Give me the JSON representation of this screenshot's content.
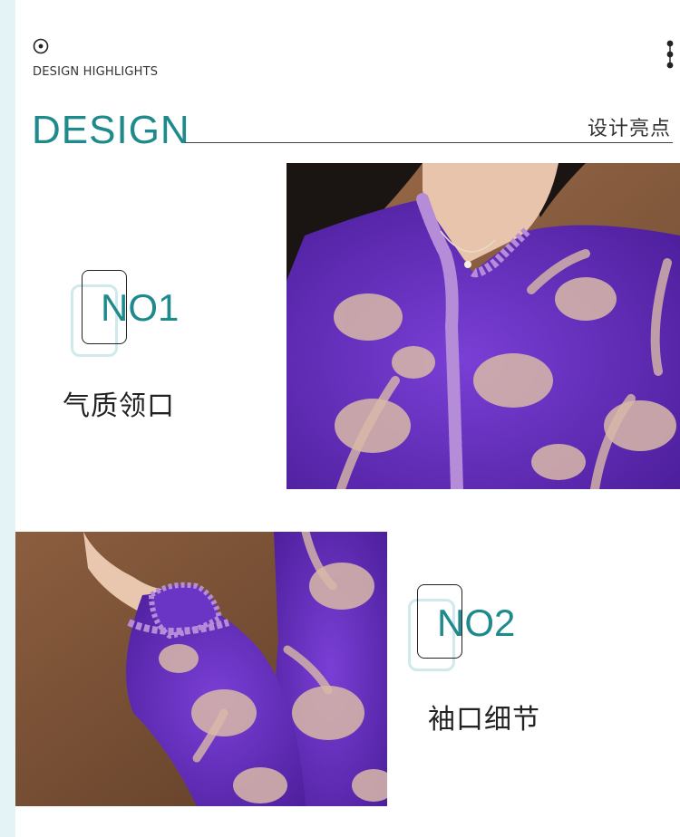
{
  "header": {
    "highlights_label": "DESIGN HIGHLIGHTS",
    "title_en": "DESIGN",
    "title_cn": "设计亮点"
  },
  "features": [
    {
      "number": "NO1",
      "label": "气质领口"
    },
    {
      "number": "NO2",
      "label": "袖口细节"
    }
  ],
  "colors": {
    "accent": "#1f8a8c",
    "strip": "#e4f4f6",
    "garment": "#6a2fc4"
  },
  "icons": {
    "top_left": "target-icon",
    "top_right": "vertical-dots-icon"
  }
}
